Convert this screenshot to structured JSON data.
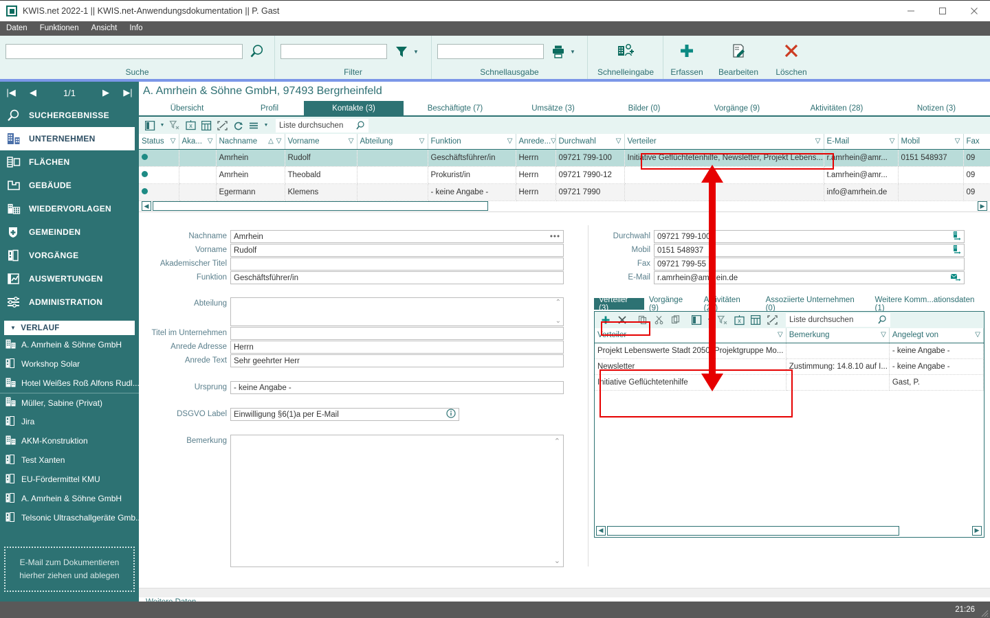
{
  "window": {
    "title": "KWIS.net 2022-1 || KWIS.net-Anwendungsdokumentation || P. Gast",
    "minimize": "—",
    "maximize": "☐",
    "close": "✕"
  },
  "menubar": {
    "items": [
      "Daten",
      "Funktionen",
      "Ansicht",
      "Info"
    ]
  },
  "ribbon": {
    "groups": [
      {
        "label": "Suche",
        "input_value": "",
        "icon": "magnifier-icon"
      },
      {
        "label": "Filter",
        "input_value": "",
        "icon": "funnel-icon"
      },
      {
        "label": "Schnellausgabe",
        "input_value": "",
        "icon": "printer-icon"
      }
    ],
    "buttons": [
      {
        "label": "Schnelleingabe",
        "icon": "quick-entry-icon"
      },
      {
        "label": "Erfassen",
        "icon": "plus-icon"
      },
      {
        "label": "Bearbeiten",
        "icon": "edit-icon"
      },
      {
        "label": "Löschen",
        "icon": "x-icon"
      }
    ]
  },
  "sidebar": {
    "pager": {
      "first": "|◀",
      "prev": "◀",
      "page": "1/1",
      "next": "▶",
      "last": "▶|"
    },
    "nav": [
      {
        "label": "SUCHERGEBNISSE",
        "icon": "magnifier-icon",
        "active": false
      },
      {
        "label": "UNTERNEHMEN",
        "icon": "company-icon",
        "active": true
      },
      {
        "label": "FLÄCHEN",
        "icon": "areas-icon",
        "active": false
      },
      {
        "label": "GEBÄUDE",
        "icon": "building-icon",
        "active": false
      },
      {
        "label": "WIEDERVORLAGEN",
        "icon": "calendar-icon",
        "active": false
      },
      {
        "label": "GEMEINDEN",
        "icon": "shield-icon",
        "active": false
      },
      {
        "label": "VORGÄNGE",
        "icon": "folder-icon",
        "active": false
      },
      {
        "label": "AUSWERTUNGEN",
        "icon": "chart-icon",
        "active": false
      },
      {
        "label": "ADMINISTRATION",
        "icon": "sliders-icon",
        "active": false
      }
    ],
    "history_header": {
      "label": "VERLAUF",
      "icon": "chevron-down-icon"
    },
    "history": [
      {
        "label": "A. Amrhein & Söhne GmbH",
        "icon": "company-icon"
      },
      {
        "label": "Workshop Solar",
        "icon": "folder-icon"
      },
      {
        "label": "Hotel Weißes Roß Alfons Rudl...",
        "icon": "company-icon"
      },
      {
        "label": "Müller, Sabine (Privat)",
        "icon": "company-icon"
      },
      {
        "label": "Jira",
        "icon": "folder-icon"
      },
      {
        "label": "AKM-Konstruktion",
        "icon": "company-icon"
      },
      {
        "label": "Test Xanten",
        "icon": "folder-icon"
      },
      {
        "label": "EU-Fördermittel KMU",
        "icon": "folder-icon"
      },
      {
        "label": "A. Amrhein & Söhne GmbH",
        "icon": "folder-icon"
      },
      {
        "label": "Telsonic Ultraschallgeräte Gmb...",
        "icon": "folder-icon"
      }
    ],
    "dropzone": {
      "line1": "E-Mail  zum Dokumentieren",
      "line2": "hierher ziehen und ablegen"
    }
  },
  "record": {
    "title": "A. Amrhein & Söhne GmbH, 97493 Bergrheinfeld",
    "tabs": [
      {
        "label": "Übersicht",
        "active": false
      },
      {
        "label": "Profil",
        "active": false
      },
      {
        "label": "Kontakte (3)",
        "active": true
      },
      {
        "label": "Beschäftigte (7)",
        "active": false
      },
      {
        "label": "Umsätze (3)",
        "active": false
      },
      {
        "label": "Bilder (0)",
        "active": false
      },
      {
        "label": "Vorgänge (9)",
        "active": false
      },
      {
        "label": "Aktivitäten (28)",
        "active": false
      },
      {
        "label": "Notizen (3)",
        "active": false
      }
    ]
  },
  "grid_toolbar": {
    "icons": [
      "columns-icon",
      "chevron-down-icon",
      "clear-filter-icon",
      "excel-export-icon",
      "table-icon",
      "expand-icon",
      "refresh-icon",
      "menu-icon",
      "chevron-down-icon"
    ],
    "search_placeholder": "Liste durchsuchen",
    "search_icon": "magnifier-icon"
  },
  "contacts_grid": {
    "columns": [
      "Status",
      "Aka...",
      "Nachname",
      "Vorname",
      "Abteilung",
      "Funktion",
      "Anrede...",
      "Durchwahl",
      "Verteiler",
      "E-Mail",
      "Mobil",
      "Fax"
    ],
    "sort_column": "Nachname",
    "sort_indicator": "△",
    "rows": [
      {
        "status": "●",
        "akademischer_titel": "",
        "nachname": "Amrhein",
        "vorname": "Rudolf",
        "abteilung": "",
        "funktion": "Geschäftsführer/in",
        "anrede": "Herrn",
        "durchwahl": "09721 799-100",
        "verteiler": "Initiative Geflüchtetenhilfe, Newsletter, Projekt Lebens...",
        "email": "r.amrhein@amr...",
        "mobil": "0151 548937",
        "fax": "09",
        "selected": true
      },
      {
        "status": "●",
        "akademischer_titel": "",
        "nachname": "Amrhein",
        "vorname": "Theobald",
        "abteilung": "",
        "funktion": "Prokurist/in",
        "anrede": "Herrn",
        "durchwahl": "09721 7990-12",
        "verteiler": "",
        "email": "t.amrhein@amr...",
        "mobil": "",
        "fax": "09",
        "selected": false
      },
      {
        "status": "●",
        "akademischer_titel": "",
        "nachname": "Egermann",
        "vorname": "Klemens",
        "abteilung": "",
        "funktion": "- keine Angabe -",
        "anrede": "Herrn",
        "durchwahl": "09721 7990",
        "verteiler": "",
        "email": "info@amrhein.de",
        "mobil": "",
        "fax": "09",
        "selected": false
      }
    ]
  },
  "detail_left": {
    "fields": [
      {
        "label": "Nachname",
        "value": "Amrhein",
        "suffix": "•••"
      },
      {
        "label": "Vorname",
        "value": "Rudolf"
      },
      {
        "label": "Akademischer Titel",
        "value": ""
      },
      {
        "label": "Funktion",
        "value": "Geschäftsführer/in"
      },
      {
        "label": "Abteilung",
        "value": "",
        "type": "textarea"
      },
      {
        "label": "Titel im Unternehmen",
        "value": ""
      },
      {
        "label": "Anrede Adresse",
        "value": "Herrn"
      },
      {
        "label": "Anrede Text",
        "value": "Sehr geehrter Herr"
      },
      {
        "label": "Ursprung",
        "value": "- keine Angabe -"
      },
      {
        "label": "DSGVO Label",
        "value": "Einwilligung §6(1)a per E-Mail",
        "info_icon": "info-icon"
      },
      {
        "label": "Bemerkung",
        "value": "",
        "type": "bigtextarea"
      }
    ],
    "footer_link": "Weitere Daten"
  },
  "detail_right": {
    "fields": [
      {
        "label": "Durchwahl",
        "value": "09721 799-100",
        "action_icon": "phone-dial-icon"
      },
      {
        "label": "Mobil",
        "value": "0151 548937",
        "action_icon": "phone-dial-icon"
      },
      {
        "label": "Fax",
        "value": "09721 799-55"
      },
      {
        "label": "E-Mail",
        "value": "r.amrhein@amrhein.de",
        "action_icon": "mail-send-icon"
      }
    ],
    "subtabs": [
      {
        "label": "Verteiler (3)",
        "active": true
      },
      {
        "label": "Vorgänge (9)",
        "active": false
      },
      {
        "label": "Aktivitäten (26)",
        "active": false
      },
      {
        "label": "Assoziierte Unternehmen (0)",
        "active": false
      },
      {
        "label": "Weitere Komm...ationsdaten (1)",
        "active": false
      }
    ],
    "subtoolbar": {
      "icons": [
        "plus-icon",
        "x-icon",
        "copy-icon",
        "cut-icon",
        "paste-icon",
        "columns-icon",
        "chevron-down-icon",
        "clear-filter-icon",
        "excel-export-icon",
        "table-icon",
        "expand-icon"
      ],
      "search_placeholder": "Liste durchsuchen",
      "search_icon": "magnifier-icon"
    },
    "verteiler_grid": {
      "columns": [
        "Verteiler",
        "Bemerkung",
        "Angelegt von"
      ],
      "rows": [
        {
          "verteiler": "Projekt Lebenswerte Stadt 2050: Projektgruppe Mo...",
          "bemerkung": "",
          "angelegt_von": "- keine Angabe -"
        },
        {
          "verteiler": "Newsletter",
          "bemerkung": "Zustimmung: 14.8.10 auf I...",
          "angelegt_von": "- keine Angabe -"
        },
        {
          "verteiler": "Initiative Geflüchtetenhilfe",
          "bemerkung": "",
          "angelegt_von": "Gast, P."
        }
      ]
    }
  },
  "statusbar": {
    "clock": "21:26"
  },
  "colors": {
    "accent": "#2d7273",
    "ribbon_bg": "#e7f4f2",
    "menu_bg": "#595959",
    "selection": "#b9dcd9",
    "annotation": "#e60000",
    "blue_strip": "#7b96e8"
  }
}
